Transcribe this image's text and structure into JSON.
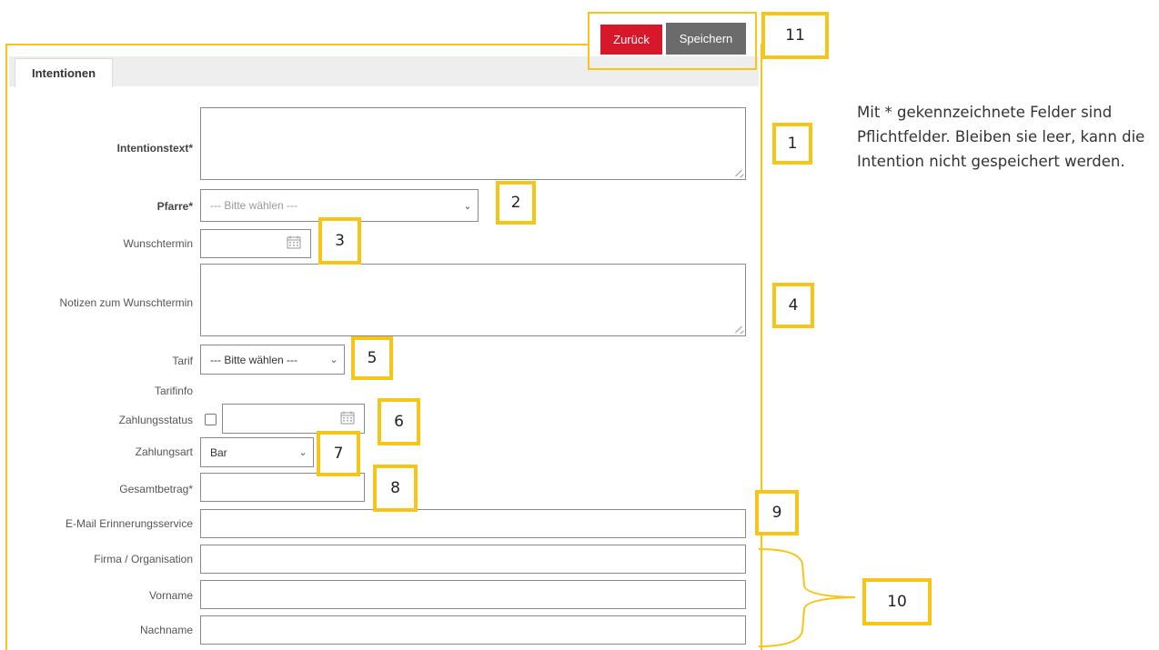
{
  "header": {
    "back_label": "Zurück",
    "save_label": "Speichern",
    "back_color": "#d7182a",
    "save_color": "#6b6b6b"
  },
  "tabs": [
    {
      "label": "Intentionen",
      "active": true
    }
  ],
  "form": {
    "intention_text_label": "Intentionstext*",
    "parish_label": "Pfarre*",
    "parish_value": "--- Bitte wählen ---",
    "desired_date_label": "Wunschtermin",
    "desired_date_notes_label": "Notizen zum Wunschtermin",
    "tariff_label": "Tarif",
    "tariff_value": "--- Bitte wählen ---",
    "tariff_info_label": "Tarifinfo",
    "payment_status_label": "Zahlungsstatus",
    "payment_method_label": "Zahlungsart",
    "payment_method_value": "Bar",
    "total_amount_label": "Gesamtbetrag*",
    "email_reminder_label": "E-Mail Erinnerungsservice",
    "company_label": "Firma / Organisation",
    "first_name_label": "Vorname",
    "last_name_label": "Nachname"
  },
  "annotations": {
    "n1": "1",
    "n2": "2",
    "n3": "3",
    "n4": "4",
    "n5": "5",
    "n6": "6",
    "n7": "7",
    "n8": "8",
    "n9": "9",
    "n10": "10",
    "n11": "11"
  },
  "note": {
    "text": "Mit * gekennzeichnete Felder sind Pflichtfelder. Bleiben sie leer, kann die Intention nicht gespeichert werden."
  },
  "colors": {
    "highlight": "#f5c518"
  }
}
